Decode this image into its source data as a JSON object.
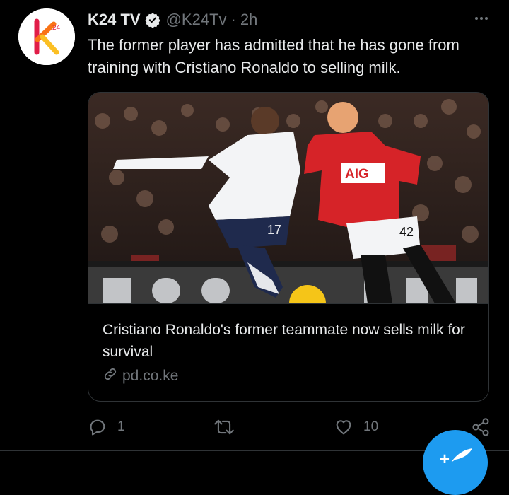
{
  "tweet": {
    "author_name": "K24 TV",
    "handle": "@K24Tv",
    "separator": "·",
    "time": "2h",
    "text": "The former player has admitted that he has gone from training with Cristiano Ronaldo to selling milk.",
    "avatar_logo_text": "24",
    "verified_icon": "verified-badge-icon",
    "more_icon": "more-options-icon"
  },
  "card": {
    "title": "Cristiano Ronaldo's former teammate now sells milk for survival",
    "domain": "pd.co.ke",
    "image_description_icon": "football-match-photo",
    "image_jerseys": {
      "player_left_number": "17",
      "player_right_sponsor": "AIG",
      "player_right_number": "42"
    }
  },
  "actions": {
    "reply_count": "1",
    "retweet_count": "",
    "like_count": "10",
    "reply_icon": "reply-icon",
    "retweet_icon": "retweet-icon",
    "like_icon": "heart-icon",
    "share_icon": "share-icon"
  },
  "fab": {
    "label": "+",
    "icon": "compose-icon"
  },
  "colors": {
    "background": "#000000",
    "text": "#e7e9ea",
    "muted": "#71767b",
    "border": "#2f3336",
    "accent": "#1d9bf0"
  }
}
